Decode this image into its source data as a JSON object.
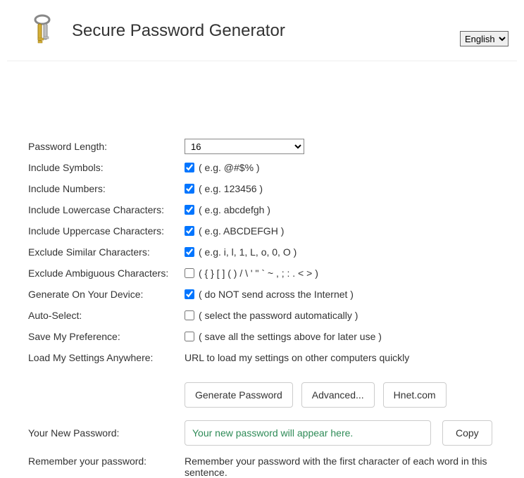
{
  "header": {
    "title": "Secure Password Generator",
    "language_selected": "English"
  },
  "form": {
    "length": {
      "label": "Password Length:",
      "value": "16"
    },
    "symbols": {
      "label": "Include Symbols:",
      "checked": true,
      "hint": "( e.g. @#$% )"
    },
    "numbers": {
      "label": "Include Numbers:",
      "checked": true,
      "hint": "( e.g. 123456 )"
    },
    "lowercase": {
      "label": "Include Lowercase Characters:",
      "checked": true,
      "hint": "( e.g. abcdefgh )"
    },
    "uppercase": {
      "label": "Include Uppercase Characters:",
      "checked": true,
      "hint": "( e.g. ABCDEFGH )"
    },
    "similar": {
      "label": "Exclude Similar Characters:",
      "checked": true,
      "hint": "( e.g. i, l, 1, L, o, 0, O )"
    },
    "ambiguous": {
      "label": "Exclude Ambiguous Characters:",
      "checked": false,
      "hint": "( { } [ ] ( ) / \\ ' \" ` ~ , ; : . < > )"
    },
    "ondevice": {
      "label": "Generate On Your Device:",
      "checked": true,
      "hint": "( do NOT send across the Internet )"
    },
    "autoselect": {
      "label": "Auto-Select:",
      "checked": false,
      "hint": "( select the password automatically )"
    },
    "savepref": {
      "label": "Save My Preference:",
      "checked": false,
      "hint": "( save all the settings above for later use )"
    },
    "loadsettings": {
      "label": "Load My Settings Anywhere:",
      "text": "URL to load my settings on other computers quickly"
    }
  },
  "buttons": {
    "generate": "Generate Password",
    "advanced": "Advanced...",
    "hnet": "Hnet.com",
    "copy": "Copy"
  },
  "output": {
    "label": "Your New Password:",
    "placeholder": "Your new password will appear here.",
    "value": ""
  },
  "remember": {
    "label": "Remember your password:",
    "text": "Remember your password with the first character of each word in this sentence."
  }
}
